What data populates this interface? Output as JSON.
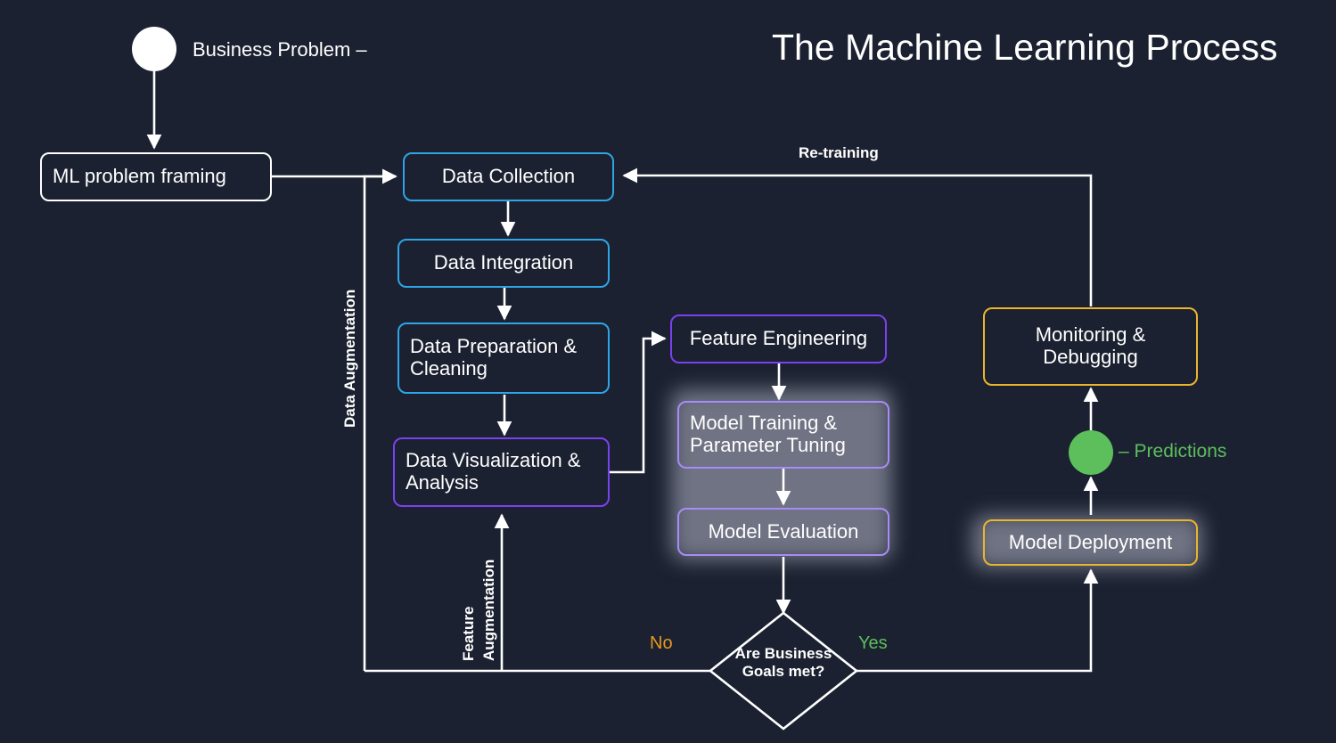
{
  "title": "The Machine Learning Process",
  "colors": {
    "background": "#1b2130",
    "white": "#ffffff",
    "blue": "#2da5e6",
    "purple": "#7b40ef",
    "purple_light": "#a78bfa",
    "yellow": "#e8b52c",
    "green": "#5cbf5c",
    "orange": "#e8981f",
    "gray_highlight": "#6f7383"
  },
  "start": {
    "marker_name": "business-problem-dot",
    "marker_color": "#ffffff",
    "label": "Business Problem –"
  },
  "end": {
    "marker_name": "predictions-dot",
    "marker_color": "#5cbf5c",
    "label": "– Predictions"
  },
  "nodes": {
    "ml_problem_framing": "ML problem framing",
    "data_collection": "Data Collection",
    "data_integration": "Data Integration",
    "data_preparation_cleaning": "Data Preparation &\nCleaning",
    "data_visualization_analysis": "Data Visualization &\nAnalysis",
    "feature_engineering": "Feature Engineering",
    "model_training_parameter_tuning": "Model Training &\nParameter Tuning",
    "model_evaluation": "Model Evaluation",
    "monitoring_debugging": "Monitoring &\nDebugging",
    "model_deployment": "Model Deployment"
  },
  "decision": {
    "text": "Are Business\nGoals met?",
    "no_label": "No",
    "yes_label": "Yes"
  },
  "edge_labels": {
    "retraining": "Re-training",
    "data_augmentation": "Data Augmentation",
    "feature_augmentation_line1": "Feature",
    "feature_augmentation_line2": "Augmentation"
  }
}
